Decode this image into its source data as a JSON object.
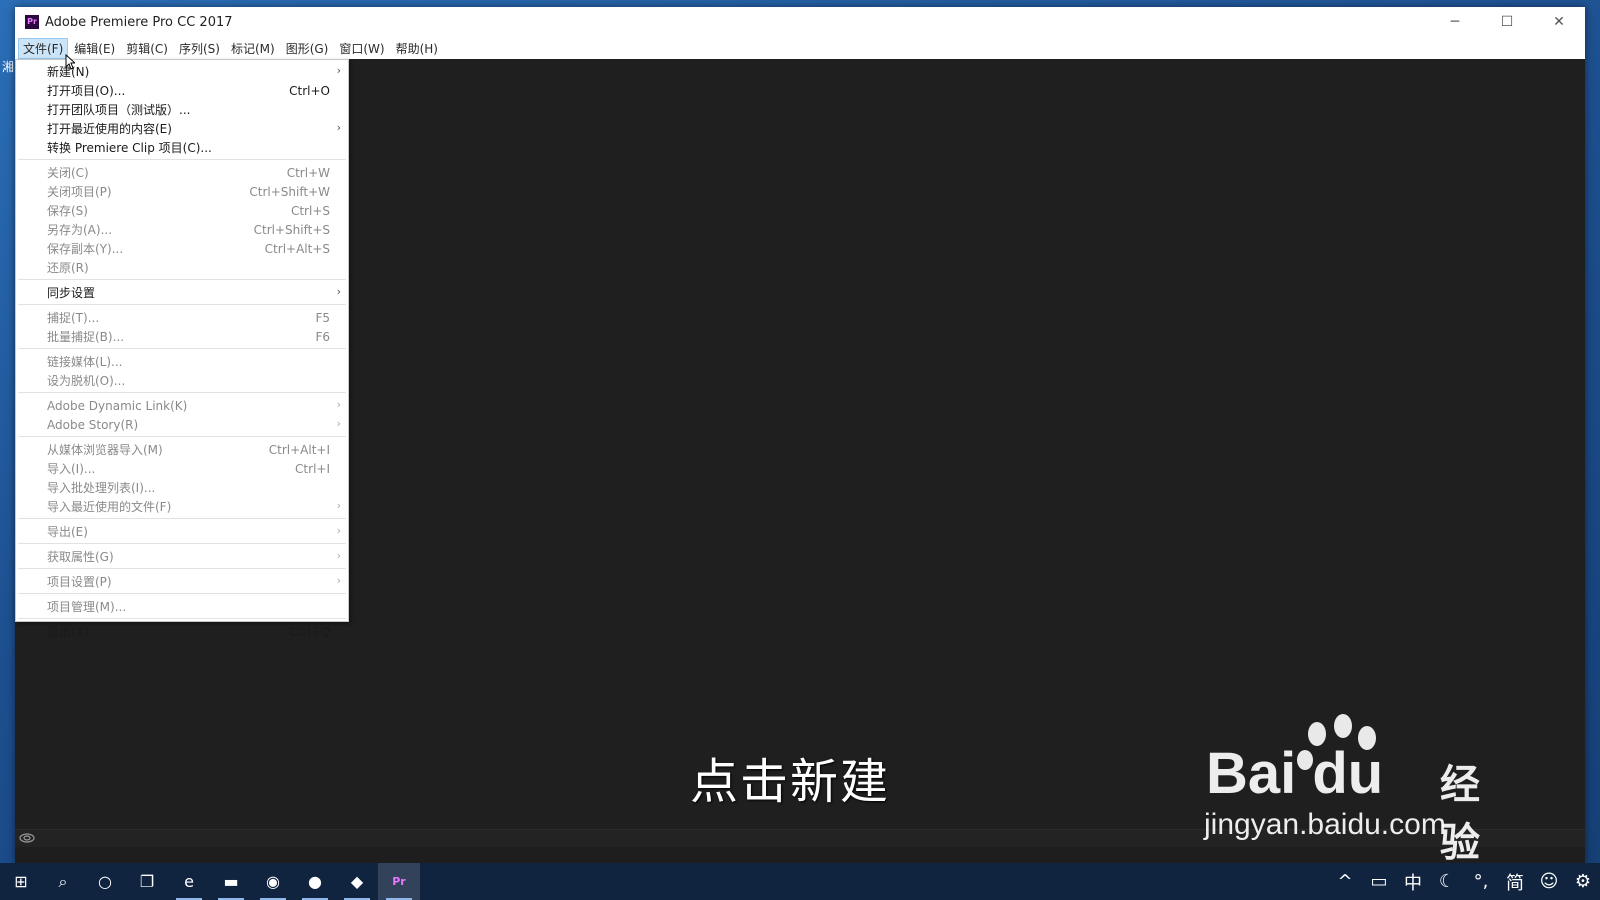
{
  "window": {
    "title": "Adobe Premiere Pro CC 2017",
    "app_icon": "Pr",
    "controls": {
      "minimize": "─",
      "maximize": "☐",
      "close": "✕"
    }
  },
  "menubar": [
    {
      "label": "文件(F)",
      "active": true
    },
    {
      "label": "编辑(E)"
    },
    {
      "label": "剪辑(C)"
    },
    {
      "label": "序列(S)"
    },
    {
      "label": "标记(M)"
    },
    {
      "label": "图形(G)"
    },
    {
      "label": "窗口(W)"
    },
    {
      "label": "帮助(H)"
    }
  ],
  "file_menu": {
    "items": [
      {
        "label": "新建(N)",
        "shortcut": "",
        "submenu": true,
        "enabled": true
      },
      {
        "label": "打开项目(O)...",
        "shortcut": "Ctrl+O",
        "submenu": false,
        "enabled": true
      },
      {
        "label": "打开团队项目（测试版）...",
        "shortcut": "",
        "submenu": false,
        "enabled": true
      },
      {
        "label": "打开最近使用的内容(E)",
        "shortcut": "",
        "submenu": true,
        "enabled": true
      },
      {
        "label": "转换 Premiere Clip 项目(C)...",
        "shortcut": "",
        "submenu": false,
        "enabled": true
      },
      {
        "separator": true
      },
      {
        "label": "关闭(C)",
        "shortcut": "Ctrl+W",
        "submenu": false,
        "enabled": false
      },
      {
        "label": "关闭项目(P)",
        "shortcut": "Ctrl+Shift+W",
        "submenu": false,
        "enabled": false
      },
      {
        "label": "保存(S)",
        "shortcut": "Ctrl+S",
        "submenu": false,
        "enabled": false
      },
      {
        "label": "另存为(A)...",
        "shortcut": "Ctrl+Shift+S",
        "submenu": false,
        "enabled": false
      },
      {
        "label": "保存副本(Y)...",
        "shortcut": "Ctrl+Alt+S",
        "submenu": false,
        "enabled": false
      },
      {
        "label": "还原(R)",
        "shortcut": "",
        "submenu": false,
        "enabled": false
      },
      {
        "separator": true
      },
      {
        "label": "同步设置",
        "shortcut": "",
        "submenu": true,
        "enabled": true
      },
      {
        "separator": true
      },
      {
        "label": "捕捉(T)...",
        "shortcut": "F5",
        "submenu": false,
        "enabled": false
      },
      {
        "label": "批量捕捉(B)...",
        "shortcut": "F6",
        "submenu": false,
        "enabled": false
      },
      {
        "separator": true
      },
      {
        "label": "链接媒体(L)...",
        "shortcut": "",
        "submenu": false,
        "enabled": false
      },
      {
        "label": "设为脱机(O)...",
        "shortcut": "",
        "submenu": false,
        "enabled": false
      },
      {
        "separator": true
      },
      {
        "label": "Adobe Dynamic Link(K)",
        "shortcut": "",
        "submenu": true,
        "enabled": false
      },
      {
        "label": "Adobe Story(R)",
        "shortcut": "",
        "submenu": true,
        "enabled": false
      },
      {
        "separator": true
      },
      {
        "label": "从媒体浏览器导入(M)",
        "shortcut": "Ctrl+Alt+I",
        "submenu": false,
        "enabled": false
      },
      {
        "label": "导入(I)...",
        "shortcut": "Ctrl+I",
        "submenu": false,
        "enabled": false
      },
      {
        "label": "导入批处理列表(I)...",
        "shortcut": "",
        "submenu": false,
        "enabled": false
      },
      {
        "label": "导入最近使用的文件(F)",
        "shortcut": "",
        "submenu": true,
        "enabled": false
      },
      {
        "separator": true
      },
      {
        "label": "导出(E)",
        "shortcut": "",
        "submenu": true,
        "enabled": false
      },
      {
        "separator": true
      },
      {
        "label": "获取属性(G)",
        "shortcut": "",
        "submenu": true,
        "enabled": false
      },
      {
        "separator": true
      },
      {
        "label": "项目设置(P)",
        "shortcut": "",
        "submenu": true,
        "enabled": false
      },
      {
        "separator": true
      },
      {
        "label": "项目管理(M)...",
        "shortcut": "",
        "submenu": false,
        "enabled": false
      },
      {
        "separator": true
      },
      {
        "label": "退出(X)",
        "shortcut": "Ctrl+Q",
        "submenu": false,
        "enabled": true
      }
    ]
  },
  "caption": "点击新建",
  "watermark": {
    "logo": "Bai du",
    "brand_cn": "经验",
    "url": "jingyan.baidu.com"
  },
  "taskbar": {
    "apps": [
      {
        "name": "windows-start-icon",
        "glyph": "⊞"
      },
      {
        "name": "search-icon",
        "glyph": "⌕"
      },
      {
        "name": "cortana-icon",
        "glyph": "○"
      },
      {
        "name": "task-view-icon",
        "glyph": "❐"
      },
      {
        "name": "edge-browser-icon",
        "glyph": "e"
      },
      {
        "name": "file-explorer-icon",
        "glyph": "▬"
      },
      {
        "name": "browser-icon",
        "glyph": "◉"
      },
      {
        "name": "qq-icon",
        "glyph": "●"
      },
      {
        "name": "app-icon",
        "glyph": "◆"
      },
      {
        "name": "premiere-taskbar-icon",
        "glyph": "Pr"
      }
    ],
    "tray": [
      {
        "name": "show-hidden-icons-icon",
        "glyph": "^"
      },
      {
        "name": "battery-icon",
        "glyph": "▭"
      },
      {
        "name": "ime-chinese-label",
        "glyph": "中"
      },
      {
        "name": "moon-icon",
        "glyph": "☾"
      },
      {
        "name": "punctuation-icon",
        "glyph": "°,"
      },
      {
        "name": "simplified-label",
        "glyph": "简"
      },
      {
        "name": "emoji-icon",
        "glyph": "☺"
      },
      {
        "name": "settings-gear-icon",
        "glyph": "⚙"
      }
    ]
  },
  "colors": {
    "workspace": "#1f1f1f",
    "menu_bg": "#ffffff",
    "active_menu_highlight": "#cce4f7",
    "taskbar": "#10233f"
  }
}
